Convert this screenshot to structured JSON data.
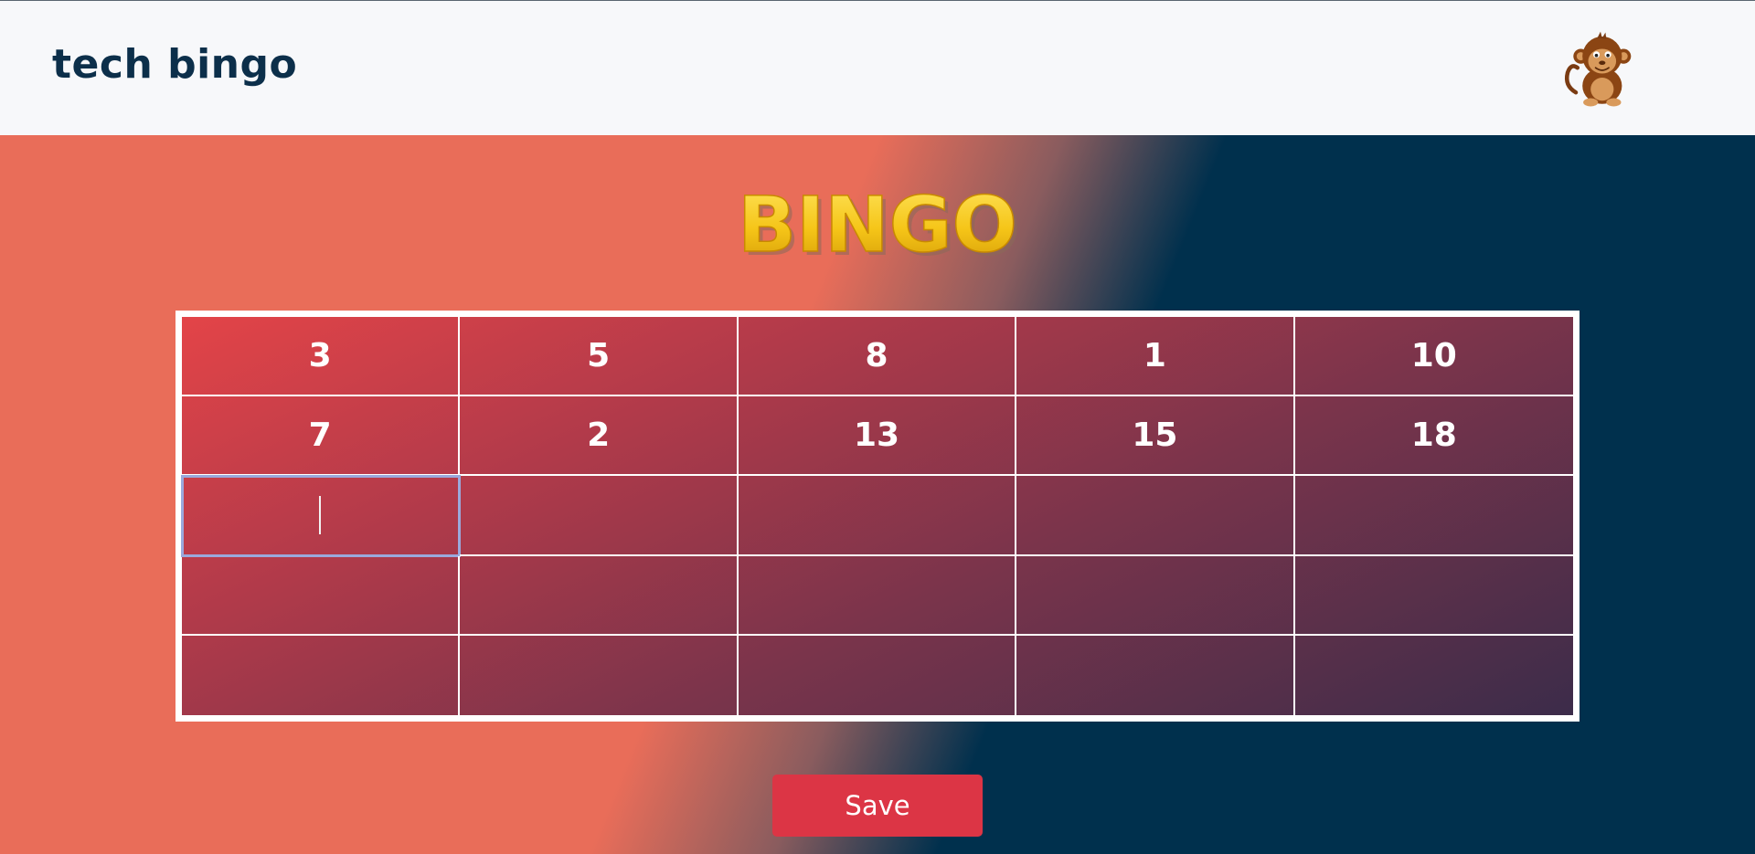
{
  "header": {
    "title": "tech bingo",
    "avatar_icon": "monkey-avatar-icon"
  },
  "logo": {
    "text": "BINGO",
    "color": "#f5c518"
  },
  "board": {
    "rows": [
      [
        "3",
        "5",
        "8",
        "1",
        "10"
      ],
      [
        "7",
        "2",
        "13",
        "15",
        "18"
      ],
      [
        "",
        "",
        "",
        "",
        ""
      ],
      [
        "",
        "",
        "",
        "",
        ""
      ],
      [
        "",
        "",
        "",
        "",
        ""
      ]
    ],
    "active_cell": [
      2,
      0
    ]
  },
  "actions": {
    "save_label": "Save"
  },
  "colors": {
    "header_bg": "#f7f8fa",
    "brand": "#0c2f4a",
    "stage_left": "#e96d59",
    "stage_right": "#00304d",
    "save_button": "#dc3545"
  }
}
